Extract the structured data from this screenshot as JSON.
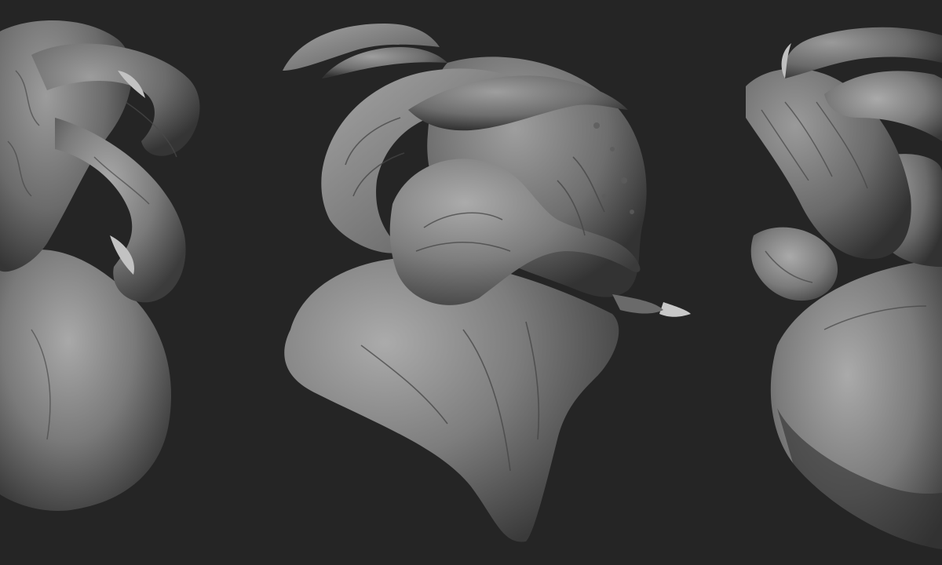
{
  "scene": {
    "background_color": "#252525",
    "material_color": "#8a8a8a",
    "shadow_color": "#3a3a3a",
    "highlight_color": "#b5b5b5",
    "views": [
      {
        "subject": "creature-bust",
        "angle": "three-quarter-front"
      },
      {
        "subject": "creature-bust",
        "angle": "side-profile"
      },
      {
        "subject": "creature-bust",
        "angle": "three-quarter-back"
      }
    ]
  }
}
